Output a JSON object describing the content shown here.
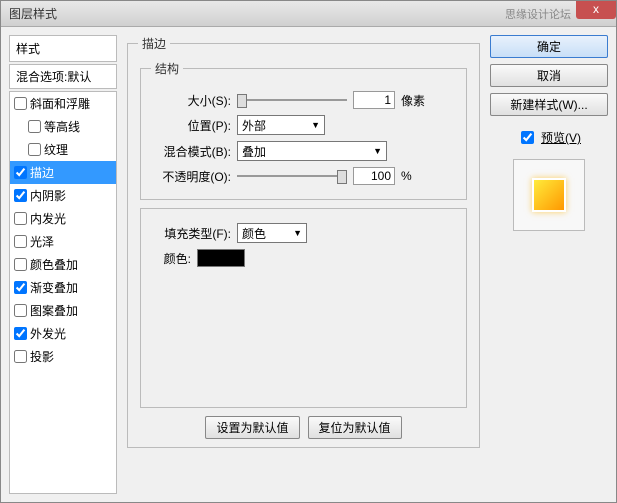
{
  "titlebar": {
    "title": "图层样式",
    "watermark": "思缘设计论坛",
    "close": "x"
  },
  "left": {
    "header": "样式",
    "blend": "混合选项:默认",
    "items": [
      {
        "label": "斜面和浮雕",
        "checked": false,
        "indent": false
      },
      {
        "label": "等高线",
        "checked": false,
        "indent": true
      },
      {
        "label": "纹理",
        "checked": false,
        "indent": true
      },
      {
        "label": "描边",
        "checked": true,
        "indent": false,
        "selected": true
      },
      {
        "label": "内阴影",
        "checked": true,
        "indent": false
      },
      {
        "label": "内发光",
        "checked": false,
        "indent": false
      },
      {
        "label": "光泽",
        "checked": false,
        "indent": false
      },
      {
        "label": "颜色叠加",
        "checked": false,
        "indent": false
      },
      {
        "label": "渐变叠加",
        "checked": true,
        "indent": false
      },
      {
        "label": "图案叠加",
        "checked": false,
        "indent": false
      },
      {
        "label": "外发光",
        "checked": true,
        "indent": false
      },
      {
        "label": "投影",
        "checked": false,
        "indent": false
      }
    ]
  },
  "middle": {
    "panel_title": "描边",
    "structure_title": "结构",
    "size_label": "大小(S):",
    "size_value": "1",
    "size_unit": "像素",
    "position_label": "位置(P):",
    "position_value": "外部",
    "blend_label": "混合模式(B):",
    "blend_value": "叠加",
    "opacity_label": "不透明度(O):",
    "opacity_value": "100",
    "opacity_unit": "%",
    "fill_type_label": "填充类型(F):",
    "fill_type_value": "颜色",
    "color_label": "颜色:",
    "color_value": "#000000",
    "btn_default": "设置为默认值",
    "btn_reset": "复位为默认值"
  },
  "right": {
    "ok": "确定",
    "cancel": "取消",
    "new_style": "新建样式(W)...",
    "preview_label": "预览(V)",
    "preview_checked": true
  }
}
